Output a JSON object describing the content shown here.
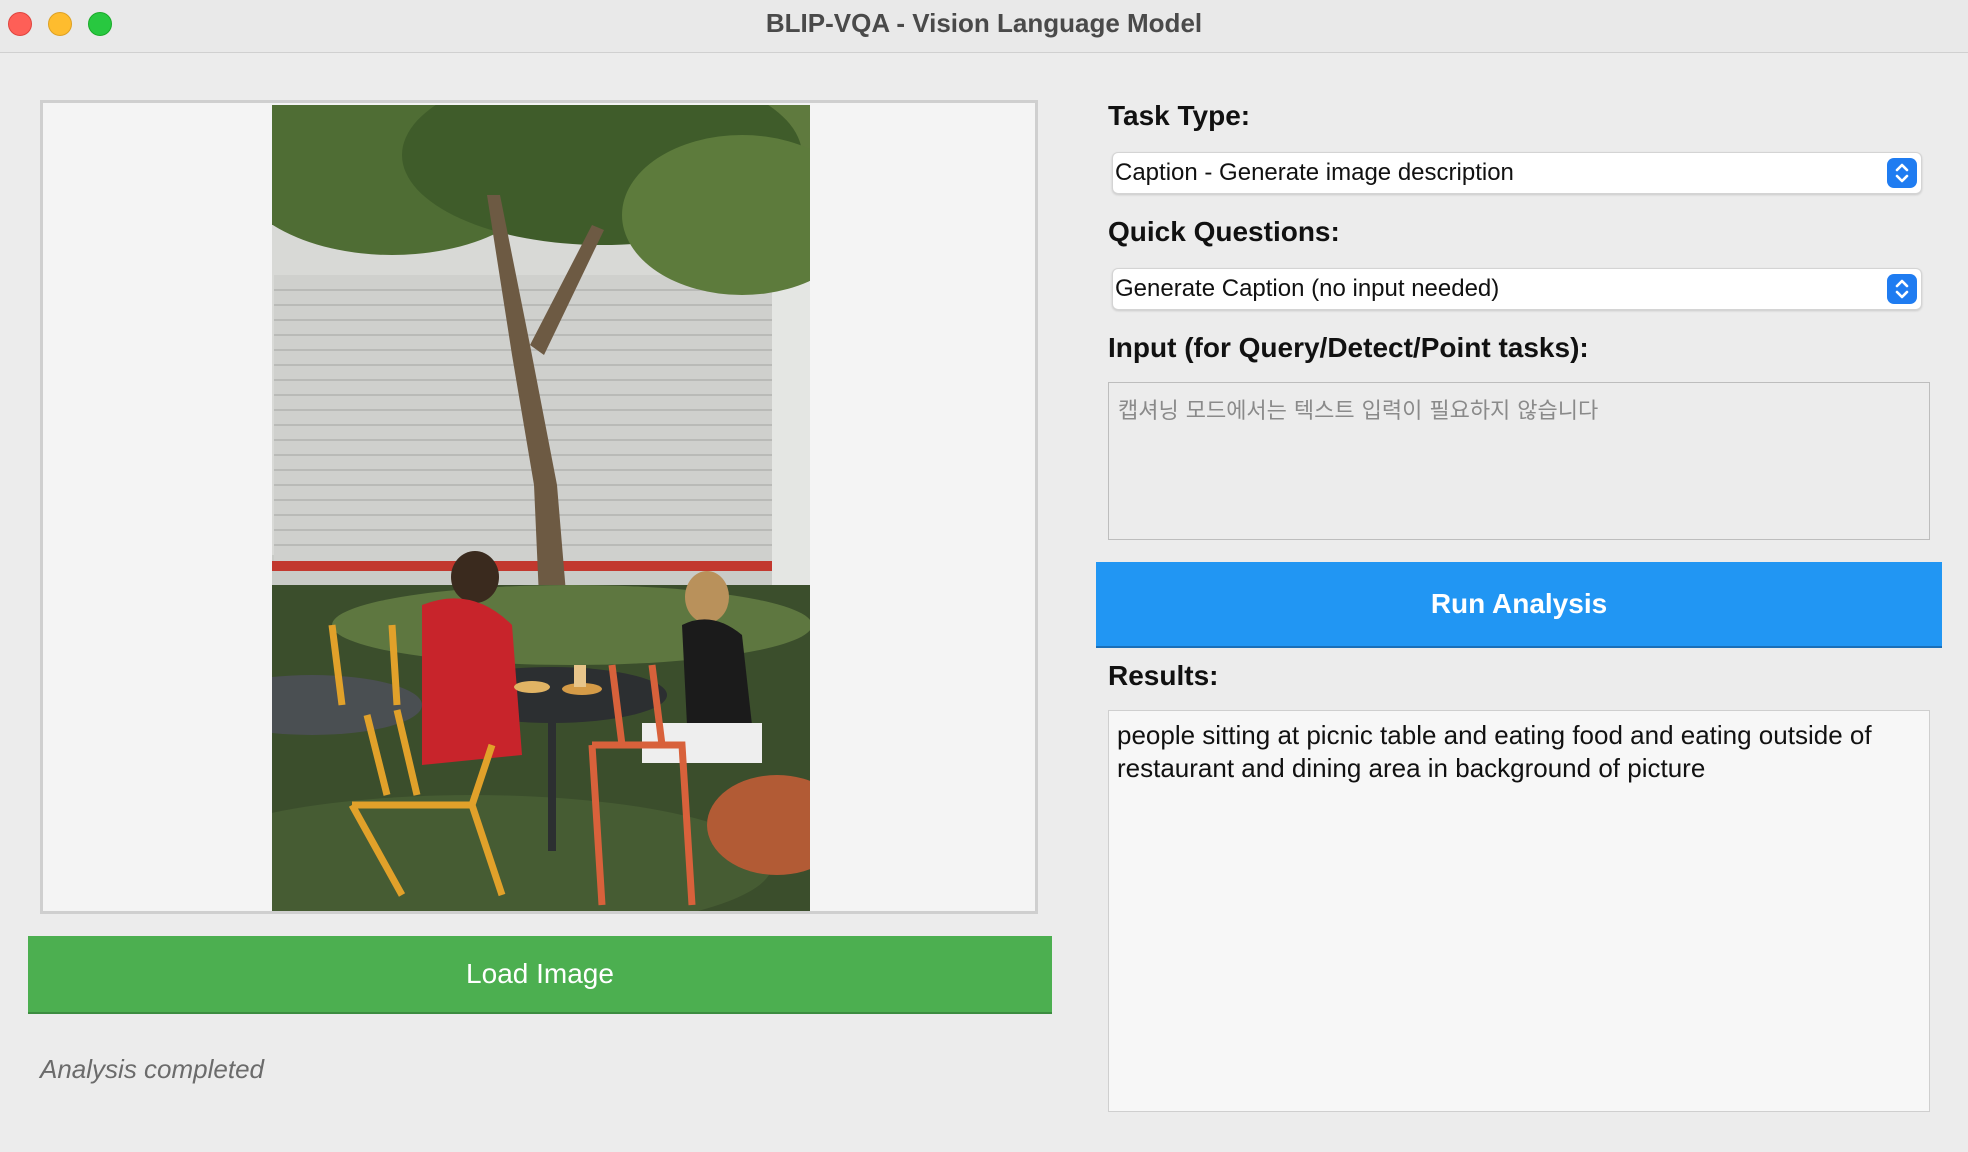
{
  "window": {
    "title": "BLIP-VQA - Vision Language Model"
  },
  "image_panel": {
    "image_alt": "Photo of two people eating at an outdoor table under a tree",
    "load_button_label": "Load Image",
    "status": "Analysis completed"
  },
  "task": {
    "label": "Task Type:",
    "selected": "Caption - Generate image description"
  },
  "quick": {
    "label": "Quick Questions:",
    "selected": "Generate Caption (no input needed)"
  },
  "input": {
    "label": "Input (for Query/Detect/Point tasks):",
    "placeholder": "캡셔닝 모드에서는 텍스트 입력이 필요하지 않습니다",
    "value": ""
  },
  "run_button_label": "Run Analysis",
  "results": {
    "label": "Results:",
    "text": "people sitting at picnic table and eating food and eating outside of restaurant and dining area in background of picture"
  },
  "colors": {
    "load_button": "#4caf50",
    "run_button": "#2196f3",
    "select_arrow": "#1f7cf1"
  },
  "icons": {
    "select_arrow": "up-down-chevron-icon"
  }
}
